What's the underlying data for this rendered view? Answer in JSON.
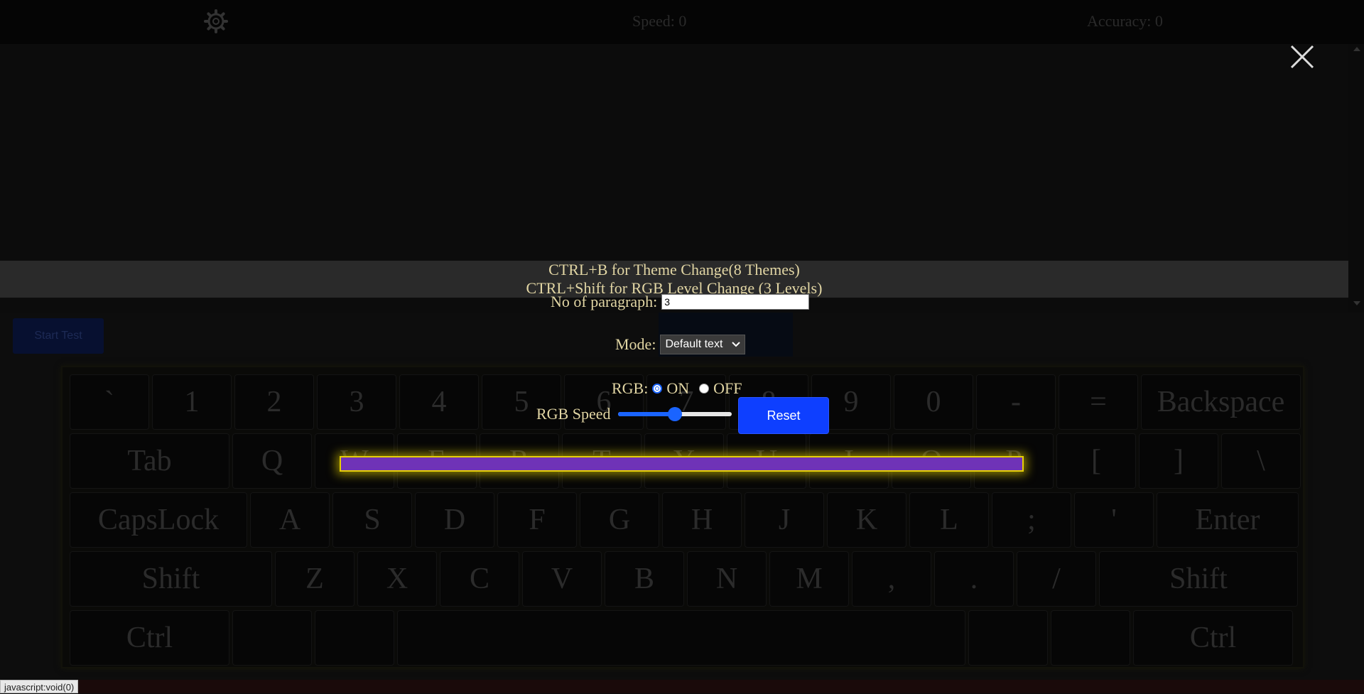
{
  "header": {
    "speed_label": "Speed: 0",
    "accuracy_label": "Accuracy: 0",
    "settings_icon": "gear-icon"
  },
  "hints": {
    "line1": "CTRL+B for Theme Change(8 Themes)",
    "line2": "CTRL+Shift for RGB Level Change (3 Levels)"
  },
  "settings": {
    "paragraph_label": "No of paragraph:",
    "paragraph_value": "3",
    "mode_label": "Mode:",
    "mode_value": "Default text",
    "rgb_label": "RGB:",
    "rgb_on_label": "ON",
    "rgb_off_label": "OFF",
    "rgb_selected": "ON",
    "rgb_speed_label": "RGB Speed",
    "rgb_speed_level": 0.5,
    "reset_label": "Reset"
  },
  "start_button": "Start Test",
  "keyboard": {
    "rows": [
      [
        "`",
        "1",
        "2",
        "3",
        "4",
        "5",
        "6",
        "7",
        "8",
        "9",
        "0",
        "-",
        "=",
        "Backspace"
      ],
      [
        "Tab",
        "Q",
        "W",
        "E",
        "R",
        "T",
        "Y",
        "U",
        "I",
        "O",
        "P",
        "[",
        "]",
        "\\"
      ],
      [
        "CapsLock",
        "A",
        "S",
        "D",
        "F",
        "G",
        "H",
        "J",
        "K",
        "L",
        ";",
        "'",
        "Enter"
      ],
      [
        "Shift",
        "Z",
        "X",
        "C",
        "V",
        "B",
        "N",
        "M",
        ",",
        ".",
        "/",
        "Shift"
      ],
      [
        "Ctrl",
        "",
        "",
        "",
        "",
        "",
        "Ctrl"
      ]
    ]
  },
  "status_url": "javascript:void(0)",
  "colors": {
    "accent": "#0e3fff",
    "rgb_bar": "#6f33b7",
    "rgb_glow": "#e6d000",
    "hint_text": "#e2d6a4"
  }
}
